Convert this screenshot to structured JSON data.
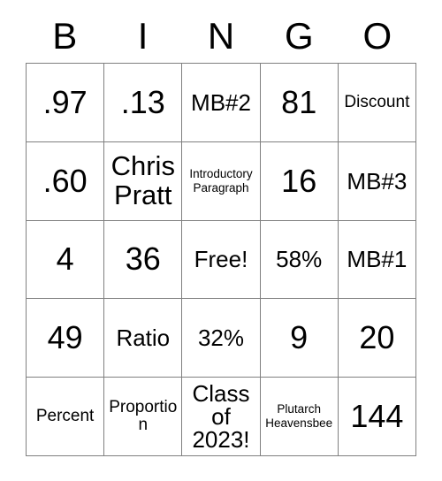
{
  "card": {
    "header": {
      "letters": [
        "B",
        "I",
        "N",
        "G",
        "O"
      ]
    },
    "rows": [
      [
        {
          "text": ".97",
          "size": "xl"
        },
        {
          "text": ".13",
          "size": "xl"
        },
        {
          "text": "MB#2",
          "size": "md"
        },
        {
          "text": "81",
          "size": "xl"
        },
        {
          "text": "Discount",
          "size": "sm"
        }
      ],
      [
        {
          "text": ".60",
          "size": "xl"
        },
        {
          "text": "Chris Pratt",
          "size": "lg"
        },
        {
          "text": "Introductory Paragraph",
          "size": "xs"
        },
        {
          "text": "16",
          "size": "xl"
        },
        {
          "text": "MB#3",
          "size": "md"
        }
      ],
      [
        {
          "text": "4",
          "size": "xl"
        },
        {
          "text": "36",
          "size": "xl"
        },
        {
          "text": "Free!",
          "size": "md"
        },
        {
          "text": "58%",
          "size": "md"
        },
        {
          "text": "MB#1",
          "size": "md"
        }
      ],
      [
        {
          "text": "49",
          "size": "xl"
        },
        {
          "text": "Ratio",
          "size": "md"
        },
        {
          "text": "32%",
          "size": "md"
        },
        {
          "text": "9",
          "size": "xl"
        },
        {
          "text": "20",
          "size": "xl"
        }
      ],
      [
        {
          "text": "Percent",
          "size": "sm"
        },
        {
          "text": "Proportion",
          "size": "sm"
        },
        {
          "text": "Class of 2023!",
          "size": "md"
        },
        {
          "text": "Plutarch Heavensbee",
          "size": "xs"
        },
        {
          "text": "144",
          "size": "xl"
        }
      ]
    ],
    "colors": {
      "text": "#000000",
      "grid_line": "#808080",
      "background": "#ffffff"
    }
  }
}
